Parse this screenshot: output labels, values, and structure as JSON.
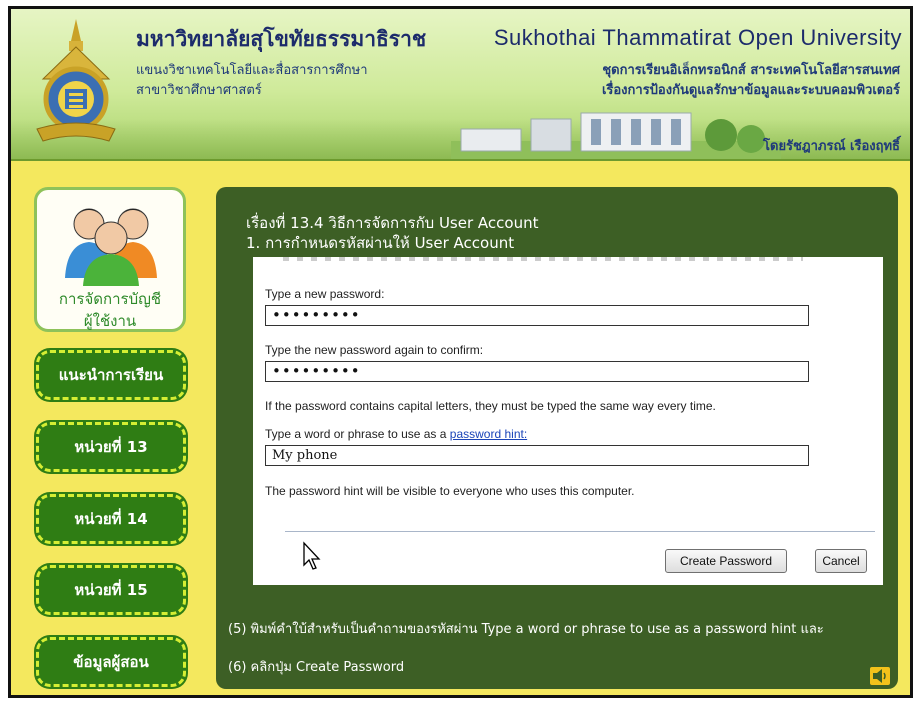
{
  "header": {
    "university_th": "มหาวิทยาลัยสุโขทัยธรรมาธิราช",
    "university_en": "Sukhothai Thammatirat Open University",
    "department_line1": "แขนงวิชาเทคโนโลยีและสื่อสารการศึกษา",
    "department_line2": "สาขาวิชาศึกษาศาสตร์",
    "series_line1": "ชุดการเรียนอิเล็กทรอนิกส์ สาระเทคโนโลยีสารสนเทศ",
    "series_line2": "เรื่องการป้องกันดูแลรักษาข้อมูลและระบบคอมพิวเตอร์",
    "author": "โดยรัชฎาภรณ์ เรืองฤทธิ์",
    "logo_icon": "university-crest-icon"
  },
  "sidebar": {
    "avatar_icon": "users-group-icon",
    "avatar_label_line1": "การจัดการบัญชี",
    "avatar_label_line2": "ผู้ใช้งาน",
    "items": [
      {
        "label": "แนะนำการเรียน"
      },
      {
        "label": "หน่วยที่ 13"
      },
      {
        "label": "หน่วยที่ 14"
      },
      {
        "label": "หน่วยที่ 15"
      },
      {
        "label": "ข้อมูลผู้สอน"
      }
    ]
  },
  "content": {
    "title_line1": "เรื่องที่ 13.4 วิธีการจัดการกับ User Account",
    "title_line2": "1. การกำหนดรหัสผ่านให้ User Account",
    "dialog": {
      "new_password_label": "Type a new password:",
      "new_password_value": "•••••••••",
      "confirm_label": "Type the new password again to confirm:",
      "confirm_value": "•••••••••",
      "capital_note": "If the password contains capital letters, they must be typed the same way every time.",
      "hint_label_prefix": "Type a word or phrase to use as a ",
      "hint_link": "password hint:",
      "hint_value": "My phone",
      "hint_visible_note": "The password hint will be visible to everyone who uses this computer.",
      "create_button": "Create Password",
      "cancel_button": "Cancel"
    },
    "instruction_line1": "(5) พิมพ์คำใบ้สำหรับเป็นคำถามของรหัสผ่าน Type a word or phrase to use as a password hint และ",
    "instruction_line2": "(6) คลิกปุ่ม Create Password",
    "speaker_icon": "speaker-icon"
  },
  "colors": {
    "page_bg": "#f4e85e",
    "panel_bg": "#3d5f25",
    "nav_button_bg": "#2f7d14",
    "nav_button_border": "#d5ee33",
    "header_text": "#1c2b6b"
  }
}
